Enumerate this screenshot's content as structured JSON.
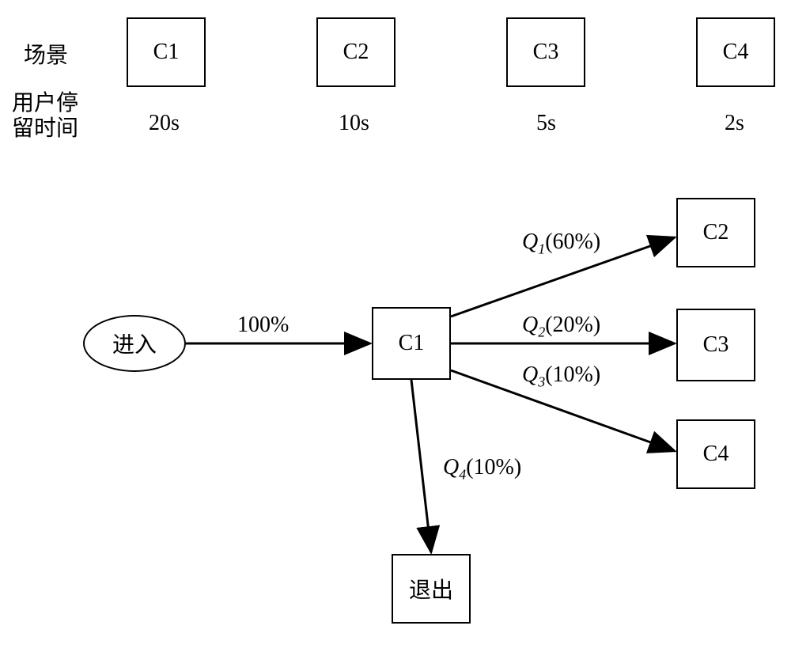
{
  "labels": {
    "scene": "场景",
    "dwell_time_line1": "用户停",
    "dwell_time_line2": "留时间"
  },
  "top_row": {
    "scenes": [
      "C1",
      "C2",
      "C3",
      "C4"
    ],
    "times": [
      "20s",
      "10s",
      "5s",
      "2s"
    ]
  },
  "flow": {
    "enter": "进入",
    "enter_prob": "100%",
    "center": "C1",
    "branches": [
      {
        "label_var": "Q",
        "label_sub": "1",
        "prob": "(60%)",
        "target": "C2"
      },
      {
        "label_var": "Q",
        "label_sub": "2",
        "prob": "(20%)",
        "target": "C3"
      },
      {
        "label_var": "Q",
        "label_sub": "3",
        "prob": "(10%)",
        "target": "C4"
      },
      {
        "label_var": "Q",
        "label_sub": "4",
        "prob": "(10%)",
        "target_exit": "退出"
      }
    ]
  }
}
